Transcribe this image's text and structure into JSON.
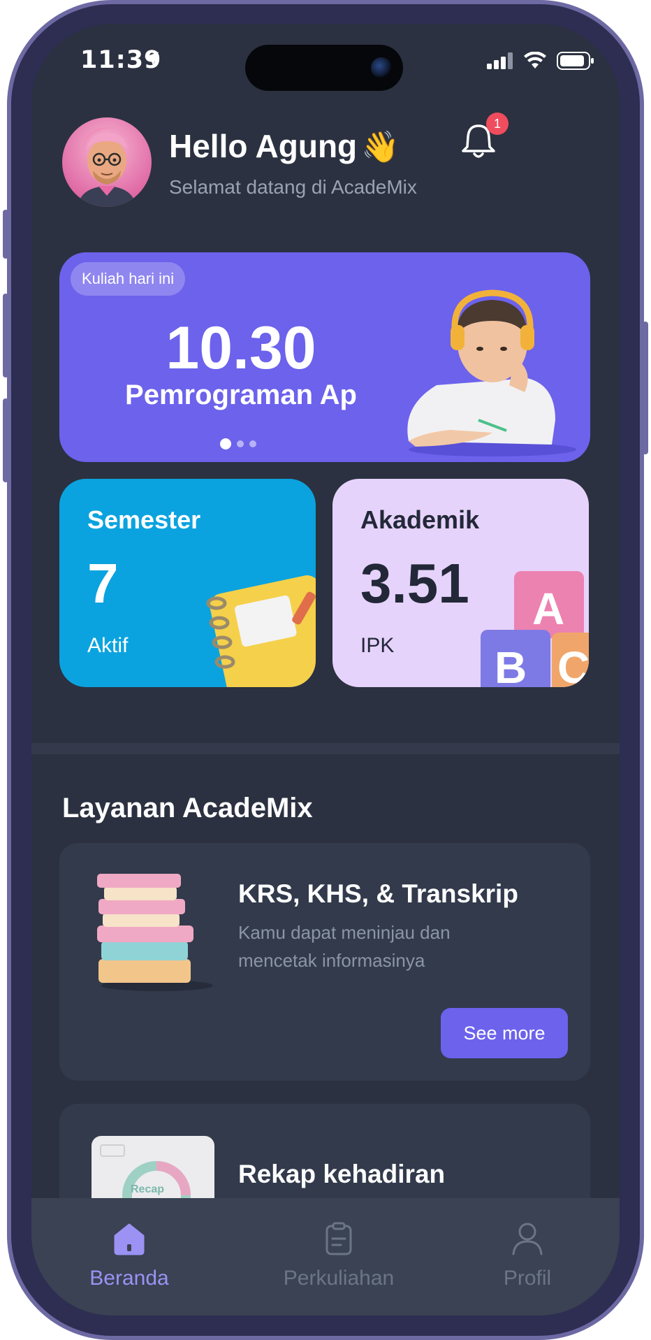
{
  "status_bar": {
    "time": "11:39",
    "icons": [
      "location-arrow-icon",
      "cellular-signal-icon",
      "wifi-icon",
      "battery-icon"
    ]
  },
  "header": {
    "greeting": "Hello Agung",
    "wave_emoji": "👋",
    "subtitle": "Selamat datang di AcadeMix",
    "notification_count": "1"
  },
  "banner": {
    "chip_label": "Kuliah hari ini",
    "time": "10.30",
    "course": "Pemrograman Ap",
    "page_count": 3,
    "active_page": 1
  },
  "cards": {
    "semester": {
      "title": "Semester",
      "value": "7",
      "caption": "Aktif"
    },
    "akademik": {
      "title": "Akademik",
      "value": "3.51",
      "caption": "IPK"
    }
  },
  "services": {
    "section_title": "Layanan AcadeMix",
    "items": [
      {
        "title": "KRS, KHS, & Transkrip",
        "description": "Kamu dapat meninjau dan mencetak informasinya",
        "button_label": "See more"
      },
      {
        "title": "Rekap kehadiran",
        "thumb_label": "Recap"
      }
    ]
  },
  "tabbar": {
    "items": [
      {
        "label": "Beranda",
        "icon": "home-icon",
        "active": true
      },
      {
        "label": "Perkuliahan",
        "icon": "clipboard-icon",
        "active": false
      },
      {
        "label": "Profil",
        "icon": "user-icon",
        "active": false
      }
    ]
  },
  "colors": {
    "background": "#2b3140",
    "accent": "#6c62ec",
    "semester_card": "#0ba3df",
    "akademik_card": "#e6d3fb",
    "badge": "#ef4d5e"
  }
}
